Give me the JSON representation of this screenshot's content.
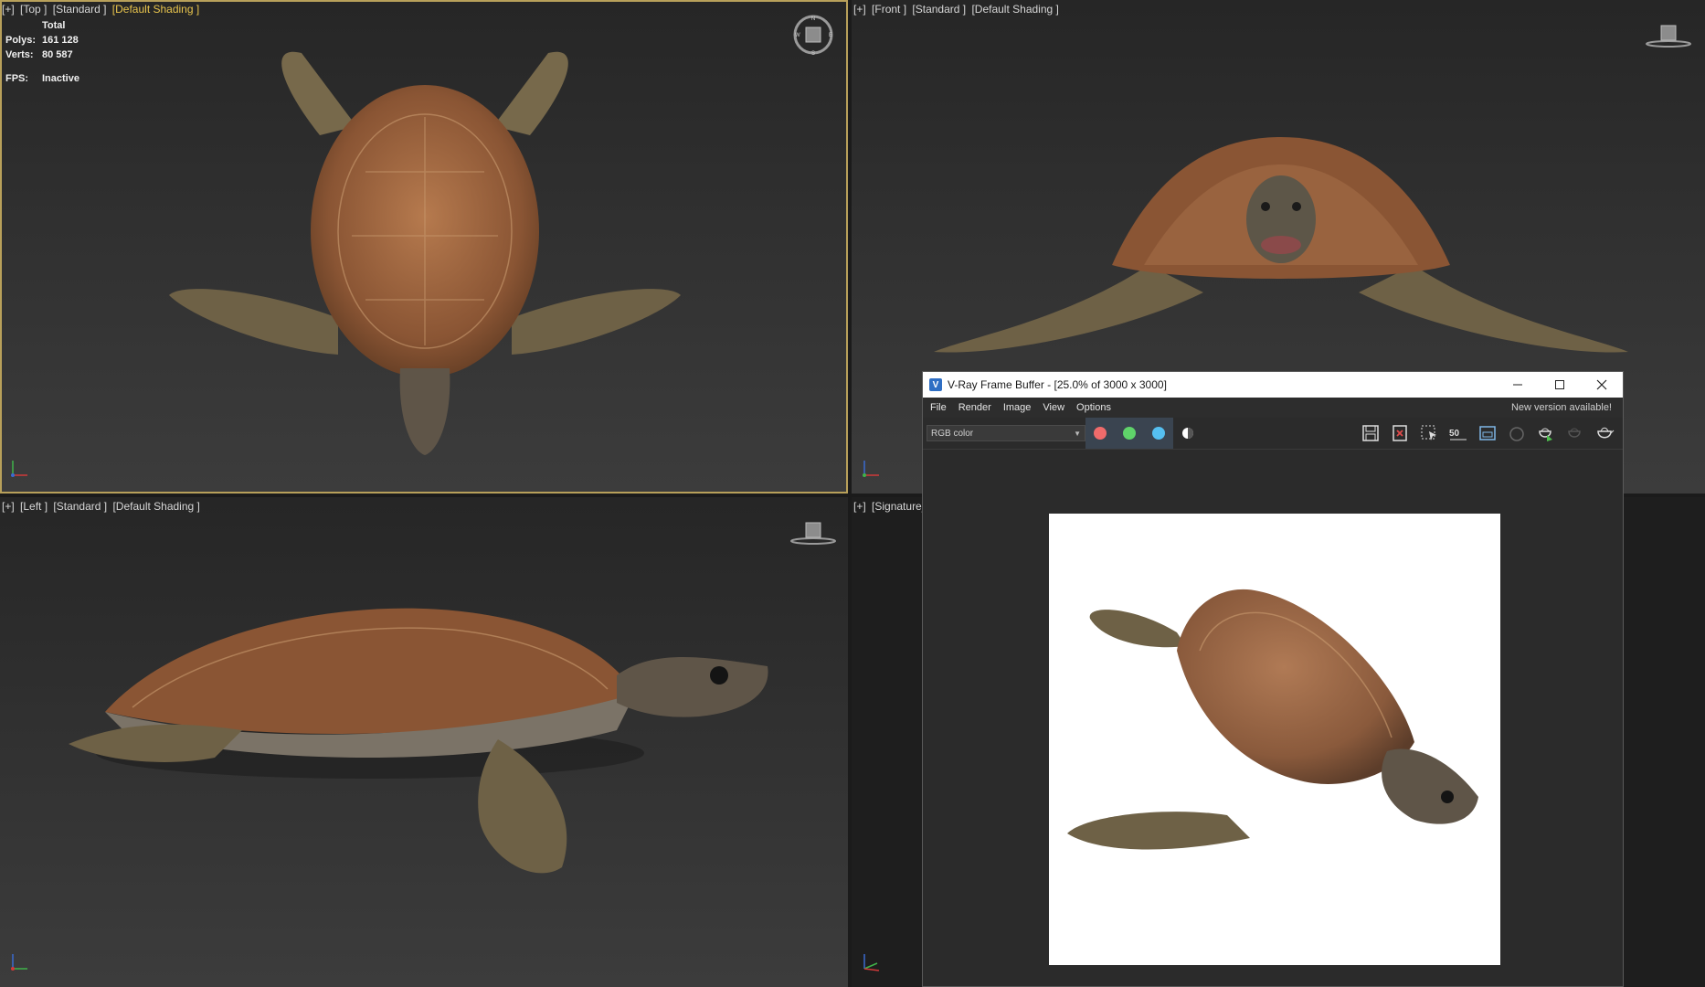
{
  "viewports": {
    "top": {
      "labels": [
        "[+]",
        "[Top ]",
        "[Standard ]",
        "[Default Shading ]"
      ]
    },
    "front": {
      "labels": [
        "[+]",
        "[Front ]",
        "[Standard ]",
        "[Default Shading ]"
      ]
    },
    "left": {
      "labels": [
        "[+]",
        "[Left ]",
        "[Standard ]",
        "[Default Shading ]"
      ]
    },
    "persp": {
      "labels": [
        "[+]",
        "[Signature_"
      ]
    }
  },
  "stats": {
    "total_label": "Total",
    "polys_label": "Polys:",
    "polys_value": "161 128",
    "verts_label": "Verts:",
    "verts_value": "80 587",
    "fps_label": "FPS:",
    "fps_value": "Inactive"
  },
  "vfb": {
    "logo": "V",
    "title": "V-Ray Frame Buffer - [25.0% of 3000 x 3000]",
    "menu": [
      "File",
      "Render",
      "Image",
      "View",
      "Options"
    ],
    "notice": "New version available!",
    "channel": "RGB color",
    "zoom_icon_text": "50",
    "colors": {
      "red": "#f06b6b",
      "green": "#5fd36a",
      "blue": "#55bff0"
    }
  },
  "icons": {
    "viewcube": "viewcube-icon",
    "axis": "axis-tripod-icon",
    "minimize": "minimize-icon",
    "maximize": "maximize-icon",
    "close": "close-icon",
    "dropdown": "chevron-down-icon"
  }
}
